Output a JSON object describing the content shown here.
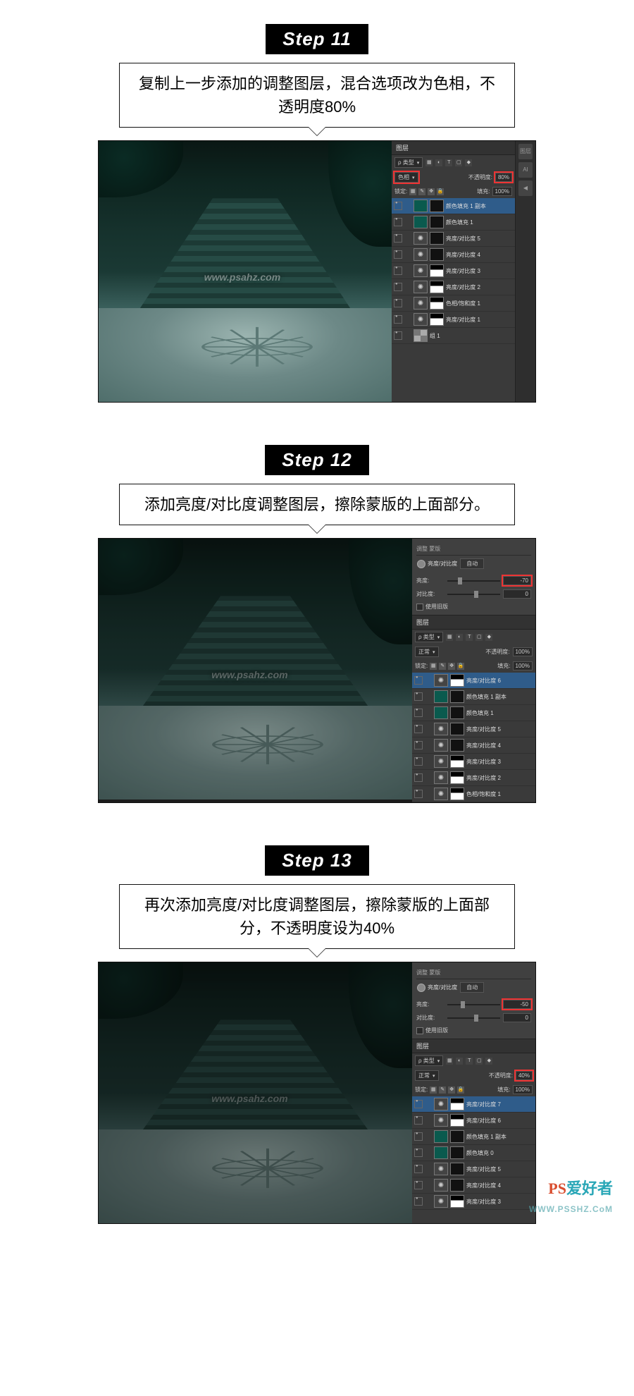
{
  "watermarks": {
    "center": "www.psahz.com",
    "bottom_logo": "PS",
    "bottom_logo_2": "爱好者",
    "bottom_url": "WWW.PSSHZ.CoM"
  },
  "steps": [
    {
      "title": "Step 11",
      "desc": "复制上一步添加的调整图层，混合选项改为色相，不透明度80%",
      "canvas_variant": "bright",
      "show_props": false,
      "side_icons": [
        "图层",
        "AI",
        "◀"
      ],
      "layers_panel": {
        "tab": "图层",
        "filter": "ρ 类型",
        "blend_mode": "色相",
        "blend_highlight": true,
        "opacity_label": "不透明度:",
        "opacity": "80%",
        "opacity_highlight": true,
        "lock_label": "锁定:",
        "fill_label": "填充:",
        "fill": "100%",
        "layers": [
          {
            "selected": true,
            "thumbs": [
              "solid",
              "mask"
            ],
            "name": "颜色填充 1 副本"
          },
          {
            "thumbs": [
              "solid",
              "mask"
            ],
            "name": "颜色填充 1"
          },
          {
            "thumbs": [
              "adj",
              "mask"
            ],
            "name": "亮度/对比度 5"
          },
          {
            "thumbs": [
              "adj",
              "mask"
            ],
            "name": "亮度/对比度 4"
          },
          {
            "thumbs": [
              "adj",
              "masked"
            ],
            "name": "亮度/对比度 3"
          },
          {
            "thumbs": [
              "adj",
              "masked"
            ],
            "name": "亮度/对比度 2"
          },
          {
            "thumbs": [
              "adj",
              "masked"
            ],
            "name": "色相/饱和度 1"
          },
          {
            "thumbs": [
              "adj",
              "masked"
            ],
            "name": "亮度/对比度 1"
          },
          {
            "thumbs": [
              "folder"
            ],
            "name": "组 1"
          }
        ]
      }
    },
    {
      "title": "Step 12",
      "desc": "添加亮度/对比度调整图层，擦除蒙版的上面部分。",
      "canvas_variant": "dark",
      "show_props": true,
      "side_icons": [],
      "props_panel": {
        "tabs": "调整  蒙版",
        "title": "亮度/对比度",
        "auto": "自动",
        "rows": [
          {
            "label": "亮度:",
            "value": "-70",
            "pos": "20%",
            "hl": true
          },
          {
            "label": "对比度:",
            "value": "0",
            "pos": "50%",
            "hl": false
          }
        ],
        "legacy": "使用旧版"
      },
      "layers_panel": {
        "tab": "图层",
        "filter": "ρ 类型",
        "blend_mode": "正常",
        "blend_highlight": false,
        "opacity_label": "不透明度:",
        "opacity": "100%",
        "opacity_highlight": false,
        "lock_label": "锁定:",
        "fill_label": "填充:",
        "fill": "100%",
        "layers": [
          {
            "selected": true,
            "thumbs": [
              "adj",
              "masked"
            ],
            "name": "亮度/对比度 6"
          },
          {
            "thumbs": [
              "solid",
              "mask"
            ],
            "name": "颜色填充 1 副本"
          },
          {
            "thumbs": [
              "solid",
              "mask"
            ],
            "name": "颜色填充 1"
          },
          {
            "thumbs": [
              "adj",
              "mask"
            ],
            "name": "亮度/对比度 5"
          },
          {
            "thumbs": [
              "adj",
              "mask"
            ],
            "name": "亮度/对比度 4"
          },
          {
            "thumbs": [
              "adj",
              "masked"
            ],
            "name": "亮度/对比度 3"
          },
          {
            "thumbs": [
              "adj",
              "masked"
            ],
            "name": "亮度/对比度 2"
          },
          {
            "thumbs": [
              "adj",
              "masked"
            ],
            "name": "色相/饱和度 1"
          }
        ]
      }
    },
    {
      "title": "Step 13",
      "desc": "再次添加亮度/对比度调整图层，擦除蒙版的上面部分，不透明度设为40%",
      "canvas_variant": "darker",
      "show_props": true,
      "side_icons": [],
      "props_panel": {
        "tabs": "调整  蒙版",
        "title": "亮度/对比度",
        "auto": "自动",
        "rows": [
          {
            "label": "亮度:",
            "value": "-50",
            "pos": "25%",
            "hl": true
          },
          {
            "label": "对比度:",
            "value": "0",
            "pos": "50%",
            "hl": false
          }
        ],
        "legacy": "使用旧版"
      },
      "layers_panel": {
        "tab": "图层",
        "filter": "ρ 类型",
        "blend_mode": "正常",
        "blend_highlight": false,
        "opacity_label": "不透明度:",
        "opacity": "40%",
        "opacity_highlight": true,
        "lock_label": "锁定:",
        "fill_label": "填充:",
        "fill": "100%",
        "layers": [
          {
            "selected": true,
            "thumbs": [
              "adj",
              "masked"
            ],
            "name": "亮度/对比度 7"
          },
          {
            "thumbs": [
              "adj",
              "masked"
            ],
            "name": "亮度/对比度 6"
          },
          {
            "thumbs": [
              "solid",
              "mask"
            ],
            "name": "颜色填充 1 副本"
          },
          {
            "thumbs": [
              "solid",
              "mask"
            ],
            "name": "颜色填充 0"
          },
          {
            "thumbs": [
              "adj",
              "mask"
            ],
            "name": "亮度/对比度 5"
          },
          {
            "thumbs": [
              "adj",
              "mask"
            ],
            "name": "亮度/对比度 4"
          },
          {
            "thumbs": [
              "adj",
              "masked"
            ],
            "name": "亮度/对比度 3"
          }
        ]
      }
    }
  ]
}
